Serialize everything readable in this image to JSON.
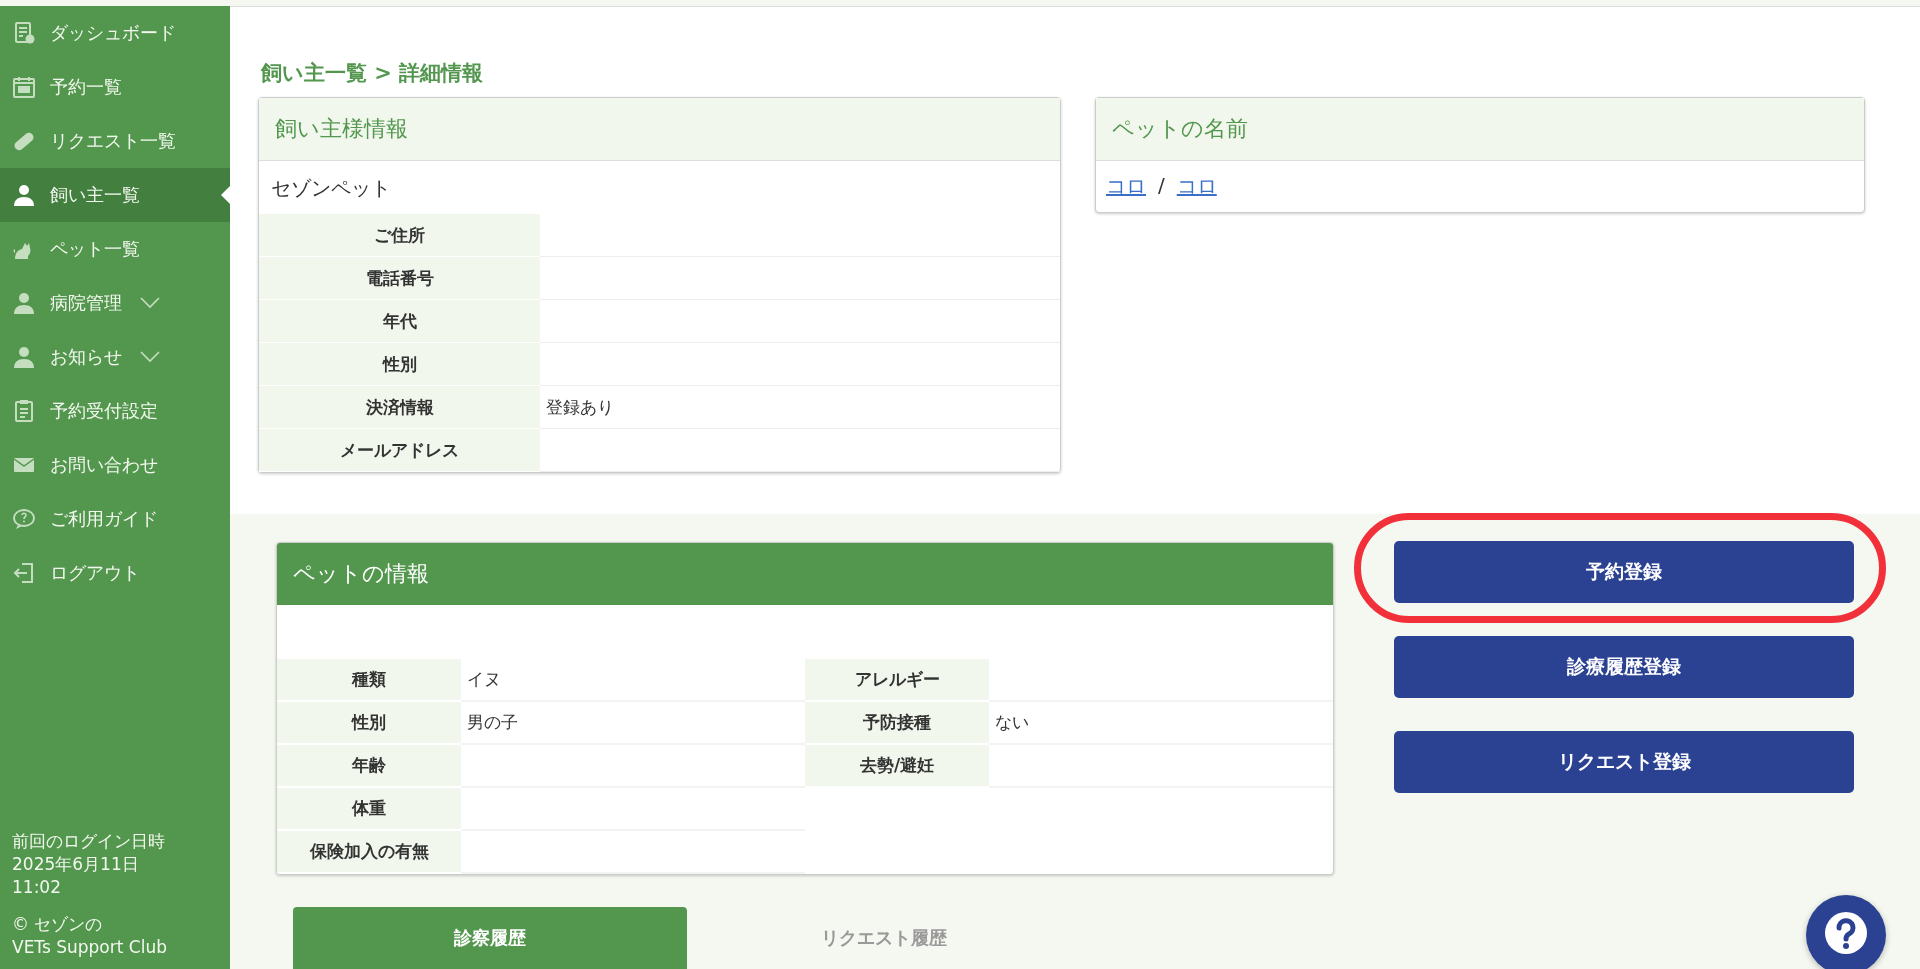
{
  "sidebar": {
    "items": [
      {
        "label": "ダッシュボード",
        "selected": false,
        "expandable": false
      },
      {
        "label": "予約一覧",
        "selected": false,
        "expandable": false
      },
      {
        "label": "リクエスト一覧",
        "selected": false,
        "expandable": false
      },
      {
        "label": "飼い主一覧",
        "selected": true,
        "expandable": false
      },
      {
        "label": "ペット一覧",
        "selected": false,
        "expandable": false
      },
      {
        "label": "病院管理",
        "selected": false,
        "expandable": true
      },
      {
        "label": "お知らせ",
        "selected": false,
        "expandable": true
      },
      {
        "label": "予約受付設定",
        "selected": false,
        "expandable": false
      },
      {
        "label": "お問い合わせ",
        "selected": false,
        "expandable": false
      },
      {
        "label": "ご利用ガイド",
        "selected": false,
        "expandable": false
      },
      {
        "label": "ログアウト",
        "selected": false,
        "expandable": false
      }
    ],
    "footer": {
      "login_lines": [
        "前回のログイン日時",
        "2025年6月11日",
        "11:02"
      ],
      "copyright_lines": [
        "© セゾンの",
        "VETs Support Club"
      ]
    }
  },
  "breadcrumb": "飼い主一覧 > 詳細情報",
  "owner_card": {
    "title": "飼い主様情報",
    "name": "セゾンペット",
    "rows": [
      {
        "label": "ご住所"
      },
      {
        "label": "電話番号"
      },
      {
        "label": "年代"
      },
      {
        "label": "性別"
      },
      {
        "label": "決済情報",
        "value": "登録あり"
      },
      {
        "label": "メールアドレス"
      }
    ]
  },
  "pet_names_card": {
    "title": "ペットの名前",
    "links": [
      "コロ",
      "コロ"
    ],
    "separator": "/"
  },
  "pet_card": {
    "title": "ペットの情報",
    "left_rows": [
      {
        "label": "種類",
        "value": "イヌ"
      },
      {
        "label": "性別",
        "value": "男の子"
      },
      {
        "label": "年齢"
      },
      {
        "label": "体重"
      },
      {
        "label": "保険加入の有無"
      }
    ],
    "right_rows": [
      {
        "label": "アレルギー"
      },
      {
        "label": "予防接種",
        "value": "ない"
      },
      {
        "label": "去勢/避妊"
      }
    ]
  },
  "tabs": [
    {
      "label": "診察履歴",
      "selected": true
    },
    {
      "label": "リクエスト履歴",
      "selected": false
    }
  ],
  "actions": [
    {
      "label": "予約登録",
      "highlighted": true
    },
    {
      "label": "診療履歴登録",
      "highlighted": false
    },
    {
      "label": "リクエスト登録",
      "highlighted": false
    }
  ]
}
